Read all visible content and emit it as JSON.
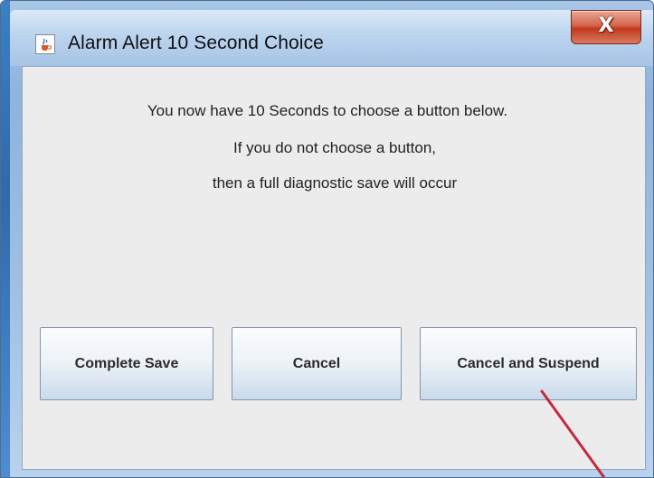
{
  "window": {
    "title": "Alarm Alert 10 Second Choice",
    "close_label": "X"
  },
  "message": {
    "line1": "You now have 10 Seconds to choose a button below.",
    "line2": "If you do not choose a button,",
    "line3": "then a full diagnostic save will occur"
  },
  "buttons": {
    "complete_save": "Complete Save",
    "cancel": "Cancel",
    "cancel_and_suspend": "Cancel and Suspend"
  },
  "icons": {
    "title_icon": "java-cup-icon",
    "close_icon": "close-icon"
  },
  "colors": {
    "annotation_arrow": "#c8283c",
    "close_button": "#c94a30"
  }
}
